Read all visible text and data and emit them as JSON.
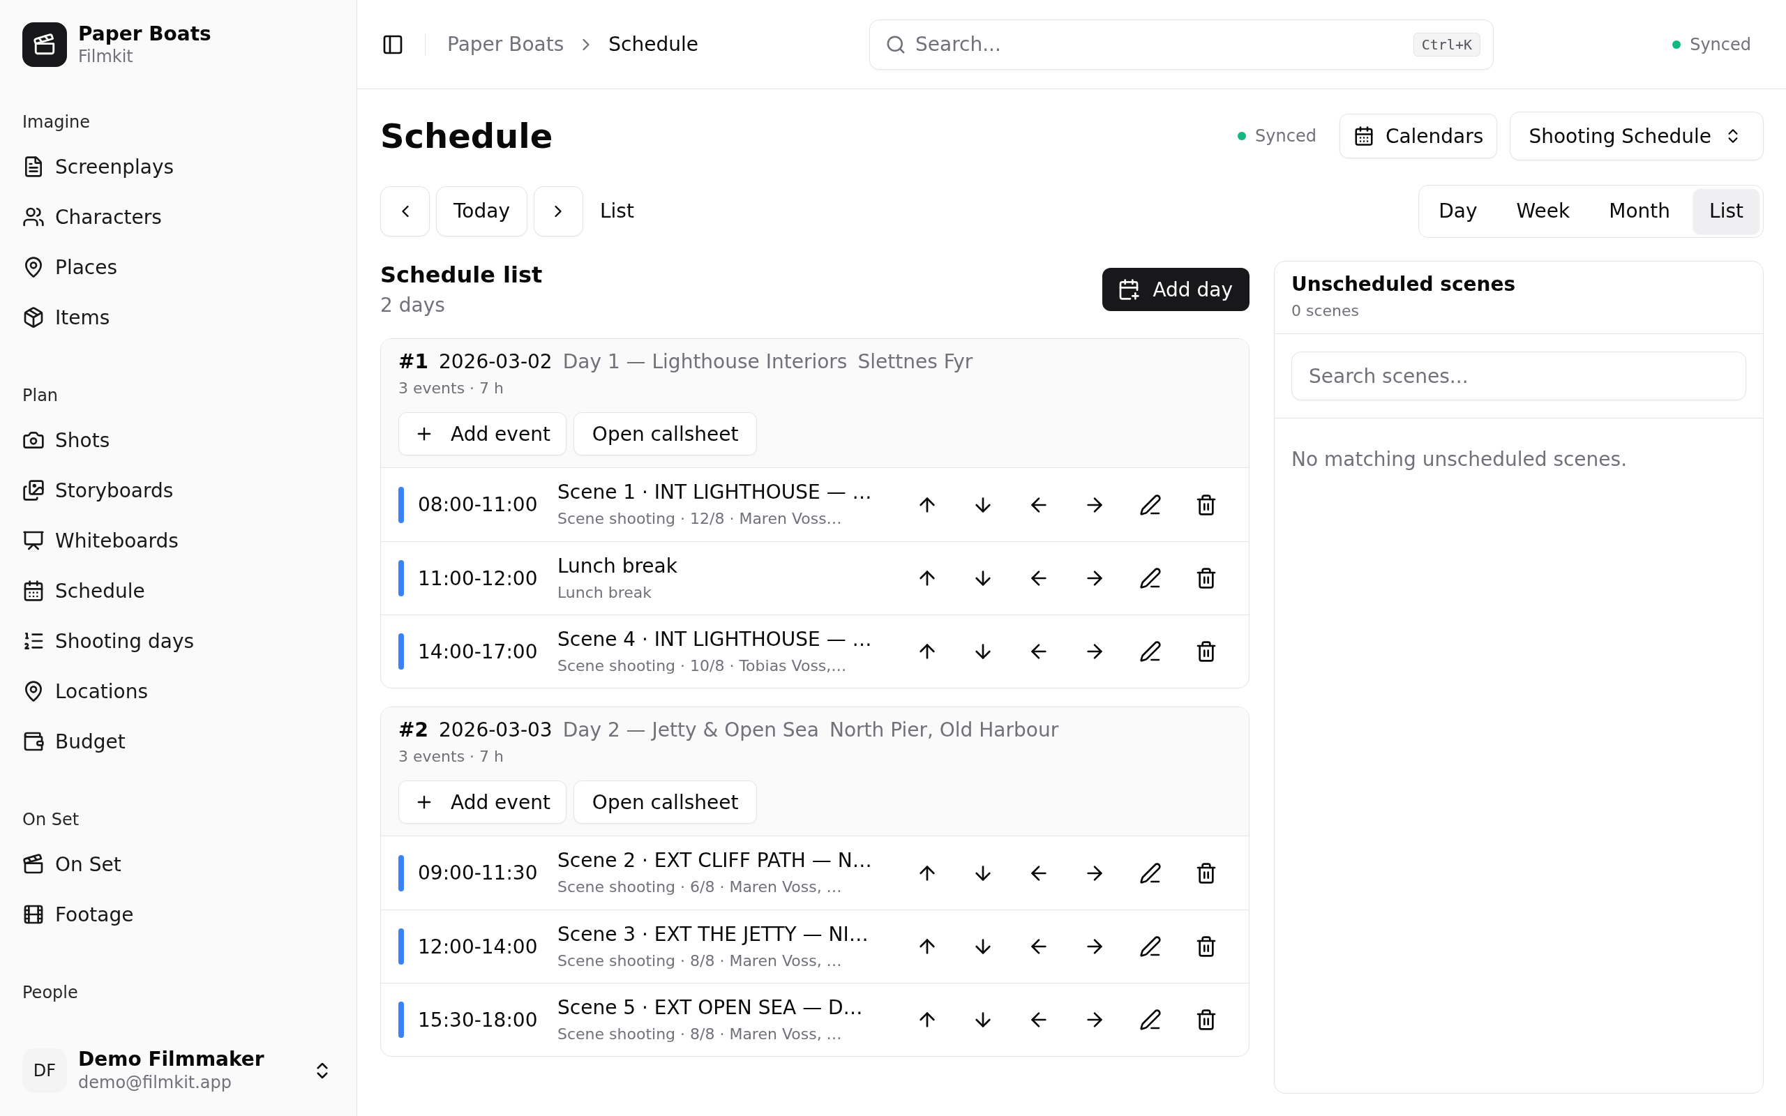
{
  "sidebar": {
    "brand": {
      "name": "Paper Boats",
      "subtitle": "Filmkit"
    },
    "sections": [
      {
        "label": "Imagine",
        "items": [
          {
            "label": "Screenplays"
          },
          {
            "label": "Characters"
          },
          {
            "label": "Places"
          },
          {
            "label": "Items"
          }
        ]
      },
      {
        "label": "Plan",
        "items": [
          {
            "label": "Shots"
          },
          {
            "label": "Storyboards"
          },
          {
            "label": "Whiteboards"
          },
          {
            "label": "Schedule"
          },
          {
            "label": "Shooting days"
          },
          {
            "label": "Locations"
          },
          {
            "label": "Budget"
          }
        ]
      },
      {
        "label": "On Set",
        "items": [
          {
            "label": "On Set"
          },
          {
            "label": "Footage"
          }
        ]
      },
      {
        "label": "People"
      }
    ],
    "user": {
      "initials": "DF",
      "name": "Demo Filmmaker",
      "email": "demo@filmkit.app"
    }
  },
  "top_bar": {
    "breadcrumbs": [
      "Paper Boats",
      "Schedule"
    ],
    "search": {
      "placeholder": "Search...",
      "shortcut": "Ctrl+K"
    },
    "status": "Synced"
  },
  "page_header": {
    "title": "Schedule",
    "status": "Synced",
    "calendars_button": "Calendars",
    "calendar_select": "Shooting Schedule"
  },
  "navigation": {
    "today_button": "Today",
    "range_label": "List",
    "views": [
      {
        "label": "Day",
        "selected": false
      },
      {
        "label": "Week",
        "selected": false
      },
      {
        "label": "Month",
        "selected": false
      },
      {
        "label": "List",
        "selected": true
      }
    ]
  },
  "schedule_list": {
    "title": "Schedule list",
    "count": "2 days",
    "add_button": "Add day",
    "days": [
      {
        "number": "#1",
        "date": "2026-03-02",
        "name": "Day 1 — Lighthouse Interiors",
        "location": "Slettnes Fyr",
        "summary": "3 events · 7 h",
        "add_event_button": "Add event",
        "callsheet_button": "Open callsheet",
        "events": [
          {
            "time": "08:00-11:00",
            "title": "Scene 1 · INT LIGHTHOUSE — …",
            "details": "Scene shooting · 12/8 · Maren Voss…",
            "color": "#3b82f6"
          },
          {
            "time": "11:00-12:00",
            "title": "Lunch break",
            "details": "Lunch break",
            "color": "#3b82f6"
          },
          {
            "time": "14:00-17:00",
            "title": "Scene 4 · INT LIGHTHOUSE — …",
            "details": "Scene shooting · 10/8 · Tobias Voss,…",
            "color": "#3b82f6"
          }
        ]
      },
      {
        "number": "#2",
        "date": "2026-03-03",
        "name": "Day 2 — Jetty & Open Sea",
        "location": "North Pier, Old Harbour",
        "summary": "3 events · 7 h",
        "add_event_button": "Add event",
        "callsheet_button": "Open callsheet",
        "events": [
          {
            "time": "09:00-11:30",
            "title": "Scene 2 · EXT CLIFF PATH — N…",
            "details": "Scene shooting · 6/8 · Maren Voss, …",
            "color": "#3b82f6"
          },
          {
            "time": "12:00-14:00",
            "title": "Scene 3 · EXT THE JETTY — NI…",
            "details": "Scene shooting · 8/8 · Maren Voss, …",
            "color": "#3b82f6"
          },
          {
            "time": "15:30-18:00",
            "title": "Scene 5 · EXT OPEN SEA — D…",
            "details": "Scene shooting · 8/8 · Maren Voss, …",
            "color": "#3b82f6"
          }
        ]
      }
    ]
  },
  "unscheduled_panel": {
    "title": "Unscheduled scenes",
    "count": "0 scenes",
    "search": {
      "placeholder": "Search scenes..."
    },
    "empty_message": "No matching unscheduled scenes."
  }
}
